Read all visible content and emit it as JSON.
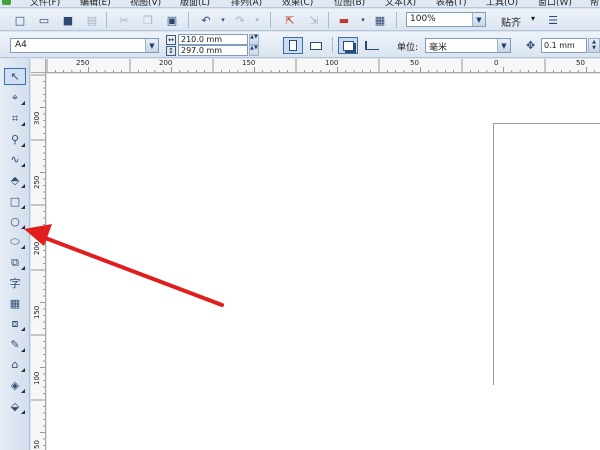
{
  "menu": {
    "items": [
      "文件(F)",
      "编辑(E)",
      "视图(V)",
      "版面(L)",
      "排列(A)",
      "效果(C)",
      "位图(B)",
      "文本(X)",
      "表格(T)",
      "工具(O)",
      "窗口(W)",
      "帮"
    ]
  },
  "toolbar": {
    "zoom_value": "100%",
    "snap_label": "贴齐"
  },
  "property_bar": {
    "paper_size": "A4",
    "width_value": "210.0 mm",
    "height_value": "297.0 mm",
    "units_label": "单位:",
    "units_value": "毫米",
    "nudge_value": "0.1 mm"
  },
  "toolbox": {
    "text_tool_glyph": "字"
  },
  "ruler": {
    "h_labels": [
      "250",
      "200",
      "150",
      "100",
      "50",
      "0",
      "50"
    ],
    "v_labels": [
      "300",
      "250",
      "200",
      "150",
      "100",
      "50"
    ]
  },
  "colors": {
    "annotation_arrow": "#e01e1e",
    "chrome_bg": "#d9e3ef",
    "canvas_bg": "#ffffff"
  }
}
